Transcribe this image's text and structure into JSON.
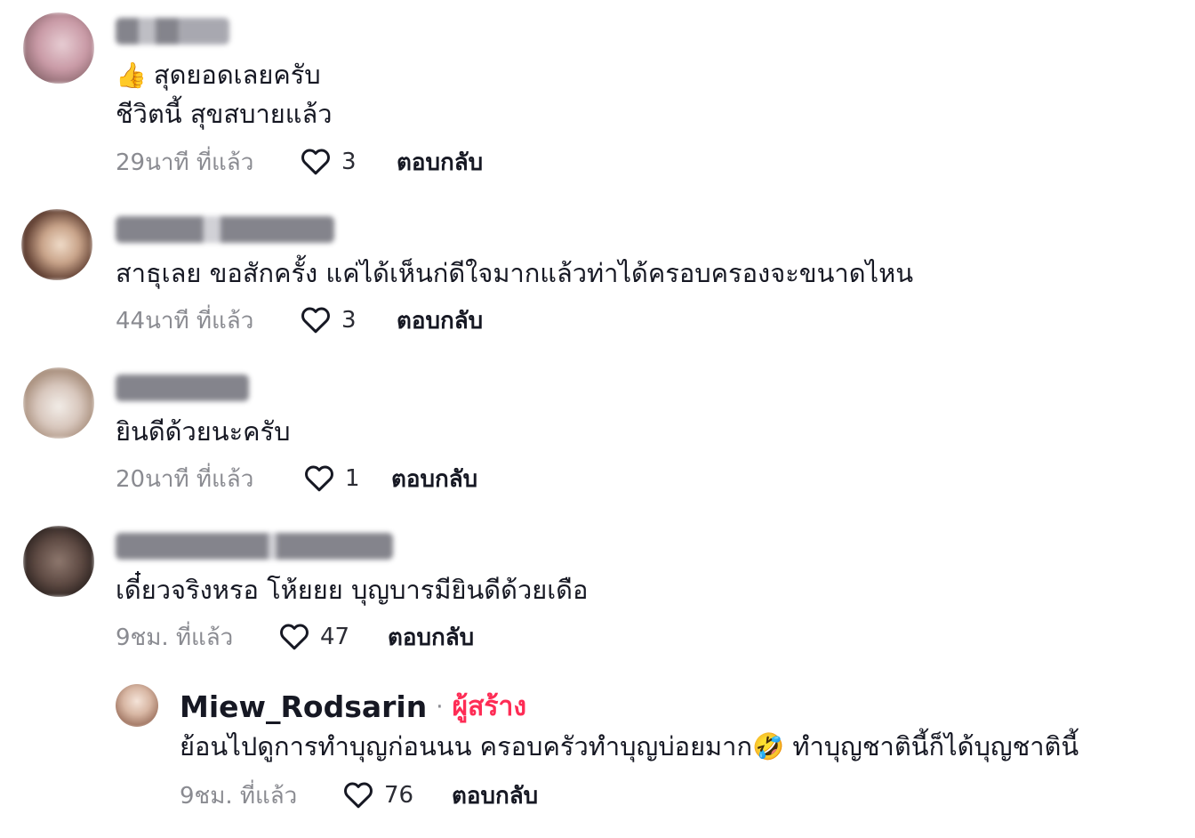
{
  "comments": [
    {
      "text_lines": [
        "สุดยอดเลยครับ",
        "ชีวิตนี้ สุขสบายแล้ว"
      ],
      "emoji_prefix": "👍",
      "time": "29นาที ที่แล้ว",
      "likes": "3",
      "reply_label": "ตอบกลับ"
    },
    {
      "text_lines": [
        "สาธุเลย ขอสักครั้ง แค่ได้เห็นก่ดีใจมากแล้วท่าได้ครอบครองจะขนาดไหน"
      ],
      "time": "44นาที ที่แล้ว",
      "likes": "3",
      "reply_label": "ตอบกลับ"
    },
    {
      "text_lines": [
        "ยินดีด้วยนะครับ"
      ],
      "time": "20นาที ที่แล้ว",
      "likes": "1",
      "reply_label": "ตอบกลับ"
    },
    {
      "text_lines": [
        "เดี๋ยวจริงหรอ โห้ยยย บุญบารมียินดีด้วยเดือ"
      ],
      "time": "9ชม. ที่แล้ว",
      "likes": "47",
      "reply_label": "ตอบกลับ"
    }
  ],
  "creator_reply": {
    "username": "Miew_Rodsarin",
    "separator": "·",
    "badge": "ผู้สร้าง",
    "text": "ย้อนไปดูการทำบุญก่อนนน ครอบครัวทำบุญบ่อยมาก🤣 ทำบุญชาตินี้ก็ได้บุญชาตินี้",
    "time": "9ชม. ที่แล้ว",
    "likes": "76",
    "reply_label": "ตอบกลับ"
  },
  "colors": {
    "primary_text": "#161823",
    "secondary_text": "#8a8b91",
    "creator_badge": "#fe2c55"
  },
  "icons": {
    "like": "heart-outline-icon"
  }
}
